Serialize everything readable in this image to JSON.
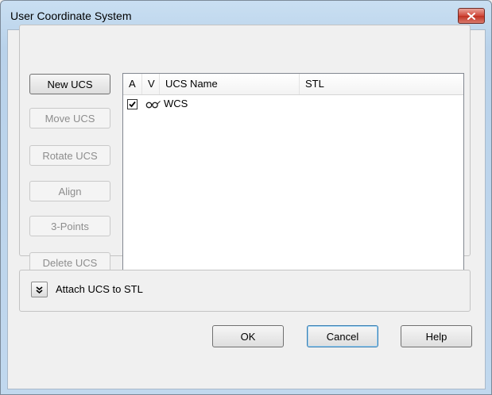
{
  "window": {
    "title": "User Coordinate System"
  },
  "side_buttons": [
    {
      "label": "New UCS",
      "enabled": true
    },
    {
      "label": "Move UCS",
      "enabled": false
    },
    {
      "label": "Rotate UCS",
      "enabled": false
    },
    {
      "label": "Align",
      "enabled": false
    },
    {
      "label": "3-Points",
      "enabled": false
    },
    {
      "label": "Delete UCS",
      "enabled": false
    }
  ],
  "ucs_list": {
    "columns": [
      "A",
      "V",
      "UCS Name",
      "STL"
    ],
    "rows": [
      {
        "active": true,
        "visible_icon": "glasses-icon",
        "name": "WCS",
        "stl": ""
      }
    ]
  },
  "attach": {
    "label": "Attach UCS to STL",
    "icon": "double-chevron-down-icon"
  },
  "footer": {
    "ok_label": "OK",
    "cancel_label": "Cancel",
    "help_label": "Help"
  },
  "colors": {
    "title_bar": "#c1d8ee",
    "close_button": "#c94a3c",
    "list_background": "#ffffff"
  }
}
